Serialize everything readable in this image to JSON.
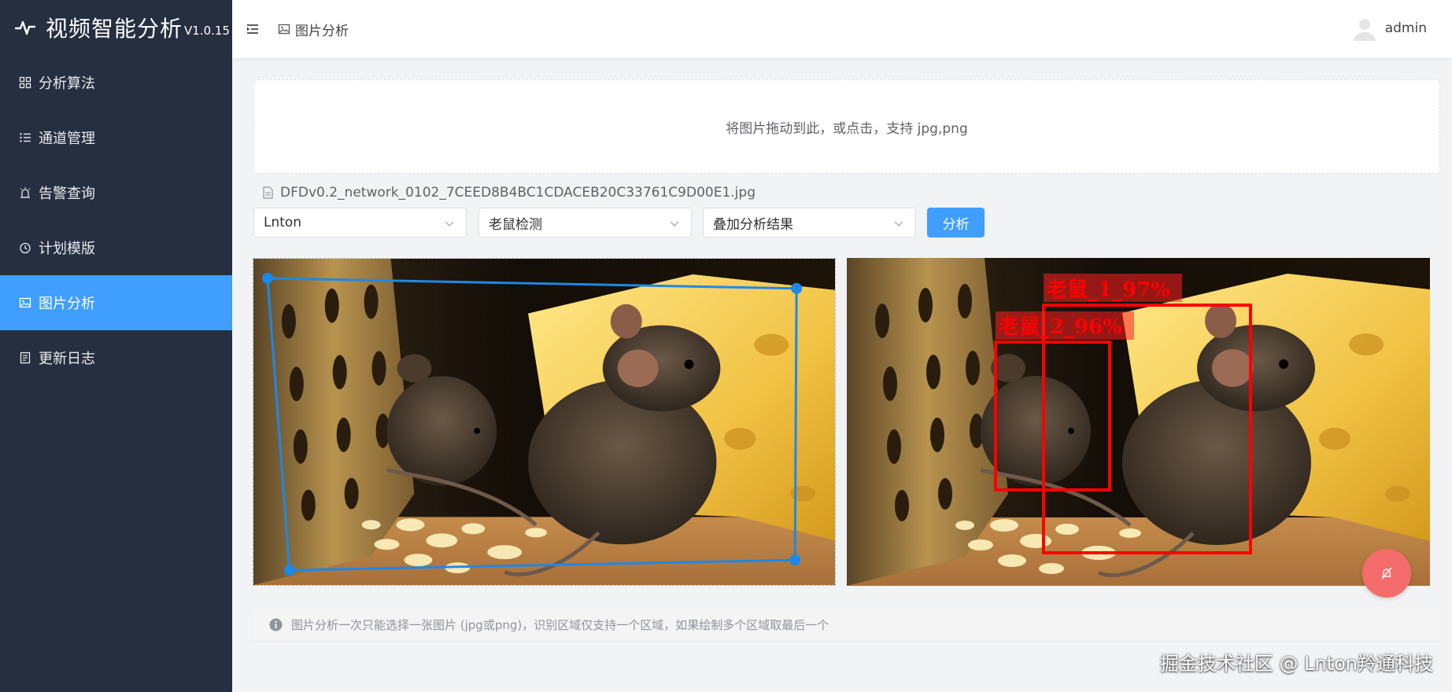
{
  "app": {
    "title": "视频智能分析",
    "version": "V1.0.15"
  },
  "sidebar": {
    "items": [
      {
        "label": "分析算法",
        "icon": "grid-icon",
        "active": false
      },
      {
        "label": "通道管理",
        "icon": "list-icon",
        "active": false
      },
      {
        "label": "告警查询",
        "icon": "alarm-light-icon",
        "active": false
      },
      {
        "label": "计划模版",
        "icon": "clock-icon",
        "active": false
      },
      {
        "label": "图片分析",
        "icon": "picture-icon",
        "active": true
      },
      {
        "label": "更新日志",
        "icon": "document-icon",
        "active": false
      }
    ]
  },
  "header": {
    "breadcrumb": "图片分析",
    "user": "admin"
  },
  "upload": {
    "hint": "将图片拖动到此，或点击，支持 jpg,png"
  },
  "file": {
    "name": "DFDv0.2_network_0102_7CEED8B4BC1CDACEB20C33761C9D00E1.jpg"
  },
  "controls": {
    "channel_select": "Lnton",
    "algorithm_select": "老鼠检测",
    "mode_select": "叠加分析结果",
    "analyze_button": "分析"
  },
  "detections": [
    {
      "label": "老鼠_1_97%"
    },
    {
      "label": "老鼠_2_96%"
    }
  ],
  "tip": {
    "text": "图片分析一次只能选择一张图片 (jpg或png)，识别区域仅支持一个区域，如果绘制多个区域取最后一个"
  },
  "watermark": "掘金技术社区 @ Lnton羚通科技",
  "colors": {
    "accent": "#409eff",
    "sidebar": "#262f40",
    "detection": "#ff0000",
    "fab": "#f56c6c",
    "region": "#1e88e5"
  }
}
